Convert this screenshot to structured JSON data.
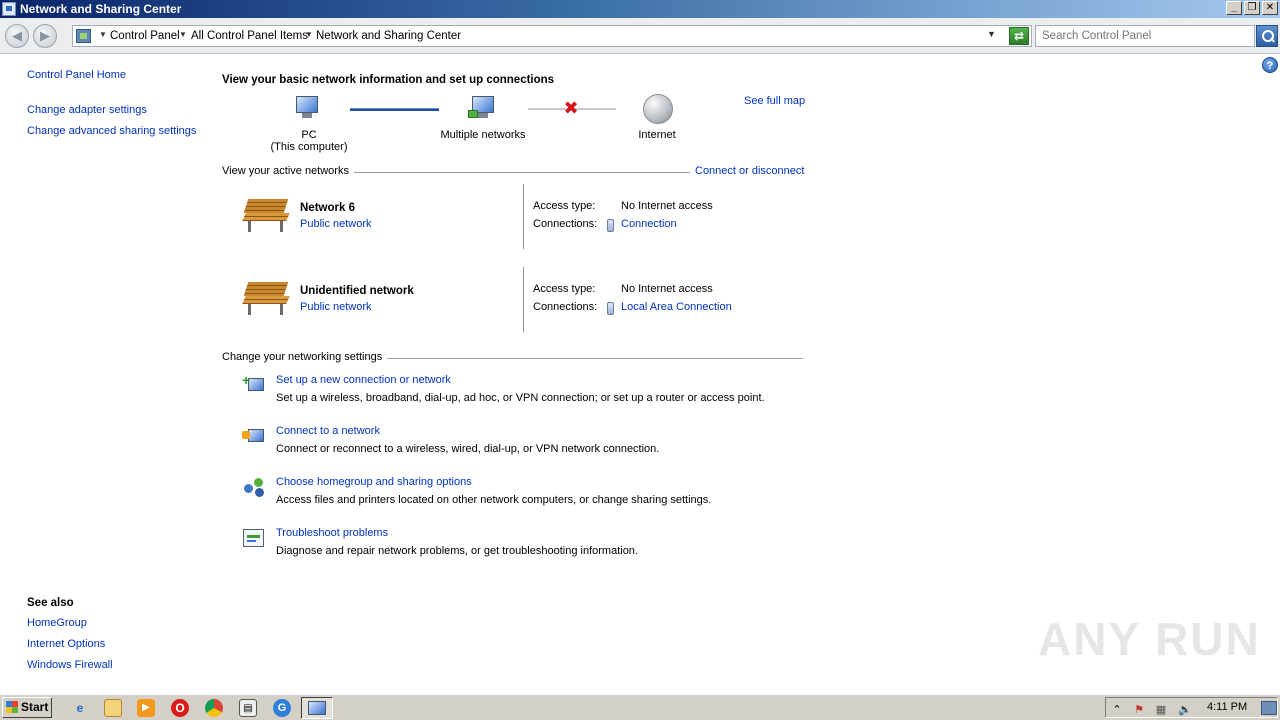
{
  "window": {
    "title": "Network and Sharing Center"
  },
  "address": {
    "crumbs": [
      "Control Panel",
      "All Control Panel Items",
      "Network and Sharing Center"
    ],
    "search_placeholder": "Search Control Panel"
  },
  "leftpane": {
    "home": "Control Panel Home",
    "links": [
      "Change adapter settings",
      "Change advanced sharing settings"
    ],
    "see_also_title": "See also",
    "see_also": [
      "HomeGroup",
      "Internet Options",
      "Windows Firewall"
    ]
  },
  "main": {
    "title": "View your basic network information and set up connections",
    "see_full_map": "See full map",
    "map": {
      "pc_line1": "PC",
      "pc_line2": "(This computer)",
      "networks": "Multiple networks",
      "internet": "Internet"
    },
    "active_label": "View your active networks",
    "connect_disconnect": "Connect or disconnect",
    "networks": [
      {
        "name": "Network  6",
        "type": "Public network",
        "access_label": "Access type:",
        "access": "No Internet access",
        "conn_label": "Connections:",
        "connection": "Connection"
      },
      {
        "name": "Unidentified network",
        "type": "Public network",
        "access_label": "Access type:",
        "access": "No Internet access",
        "conn_label": "Connections:",
        "connection": "Local Area Connection"
      }
    ],
    "settings_label": "Change your networking settings",
    "tasks": [
      {
        "link": "Set up a new connection or network",
        "desc": "Set up a wireless, broadband, dial-up, ad hoc, or VPN connection; or set up a router or access point."
      },
      {
        "link": "Connect to a network",
        "desc": "Connect or reconnect to a wireless, wired, dial-up, or VPN network connection."
      },
      {
        "link": "Choose homegroup and sharing options",
        "desc": "Access files and printers located on other network computers, or change sharing settings."
      },
      {
        "link": "Troubleshoot problems",
        "desc": "Diagnose and repair network problems, or get troubleshooting information."
      }
    ]
  },
  "taskbar": {
    "start": "Start",
    "clock": "4:11 PM"
  },
  "watermark": "ANY RUN"
}
